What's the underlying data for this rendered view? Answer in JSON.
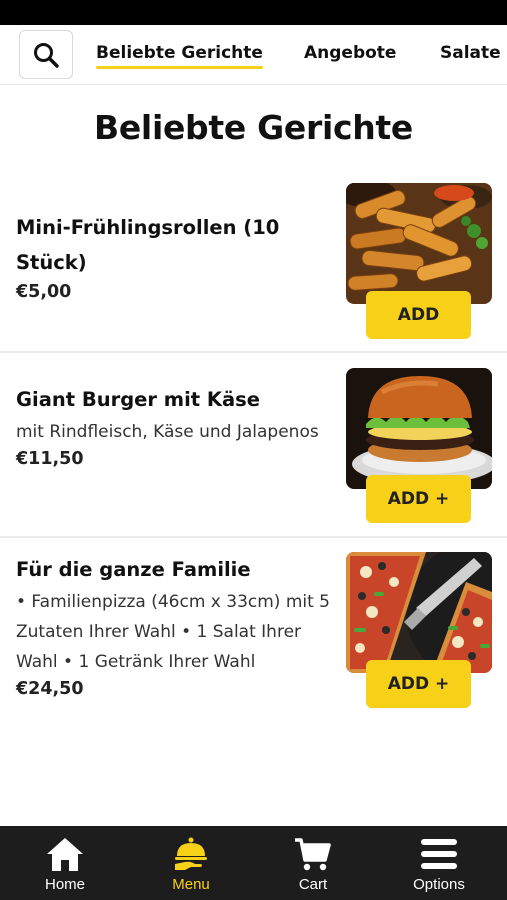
{
  "colors": {
    "accent": "#f7d117",
    "nav_bg": "#1d1d1d",
    "active_nav": "#f7d117"
  },
  "tabs": [
    {
      "label": "Beliebte Gerichte",
      "active": true
    },
    {
      "label": "Angebote",
      "active": false
    },
    {
      "label": "Salate",
      "active": false
    }
  ],
  "search": {
    "icon": "search-icon"
  },
  "section": {
    "title": "Beliebte Gerichte"
  },
  "items": [
    {
      "name": "Mini-Frühlingsrollen (10 Stück)",
      "description": "",
      "price": "€5,00",
      "button": "ADD",
      "image": "spring-rolls-photo"
    },
    {
      "name": "Giant Burger mit Käse",
      "description": "mit Rindfleisch, Käse und Jalapenos",
      "price": "€11,50",
      "button": "ADD +",
      "image": "burger-photo"
    },
    {
      "name": "Für die ganze Familie",
      "description": "• Familienpizza (46cm x 33cm) mit 5 Zutaten Ihrer Wahl • 1 Salat Ihrer Wahl • 1 Getränk Ihrer Wahl",
      "price": "€24,50",
      "button": "ADD +",
      "image": "pizza-photo"
    }
  ],
  "bottom_nav": [
    {
      "label": "Home",
      "icon": "home-icon",
      "active": false
    },
    {
      "label": "Menu",
      "icon": "cloche-icon",
      "active": true
    },
    {
      "label": "Cart",
      "icon": "cart-icon",
      "active": false
    },
    {
      "label": "Options",
      "icon": "menu-icon",
      "active": false
    }
  ]
}
